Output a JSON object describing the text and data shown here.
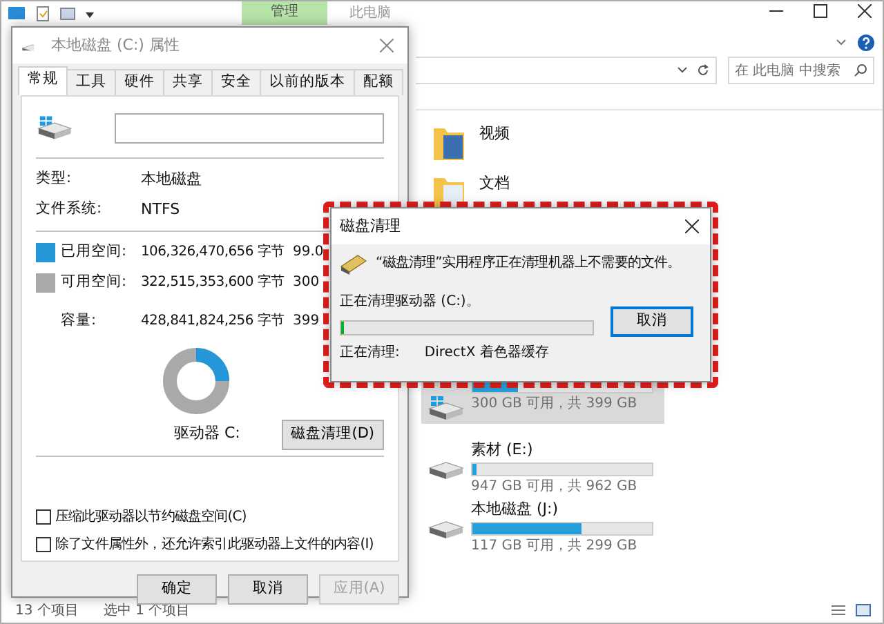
{
  "explorer": {
    "context_tab": "管理",
    "title": "此电脑",
    "search": {
      "placeholder": "在 此电脑 中搜索"
    },
    "folders": [
      {
        "name": "视频"
      },
      {
        "name": "文档"
      }
    ],
    "drives": [
      {
        "selected": true,
        "level": 0.25,
        "info": "300 GB 可用，共 399 GB"
      },
      {
        "name": "素材 (E:)",
        "selected": false,
        "level": 0.02,
        "info": "947 GB 可用，共 962 GB"
      },
      {
        "name": "本地磁盘 (J:)",
        "selected": false,
        "level": 0.61,
        "info": "117 GB 可用，共 299 GB"
      }
    ],
    "status_bar": {
      "count": "13 个项目",
      "selection": "选中 1 个项目"
    }
  },
  "properties": {
    "title": "本地磁盘 (C:) 属性",
    "tabs": [
      {
        "label": "常规",
        "selected": true
      },
      {
        "label": "工具",
        "selected": false
      },
      {
        "label": "硬件",
        "selected": false
      },
      {
        "label": "共享",
        "selected": false
      },
      {
        "label": "安全",
        "selected": false
      },
      {
        "label": "以前的版本",
        "selected": false
      },
      {
        "label": "配额",
        "selected": false
      }
    ],
    "type_label": "类型:",
    "type_value": "本地磁盘",
    "fs_label": "文件系统:",
    "fs_value": "NTFS",
    "space": [
      {
        "kind": "used",
        "color": "#2596d8",
        "label": "已用空间:",
        "bytes": "106,326,470,656 字节",
        "size": "99.0"
      },
      {
        "kind": "free",
        "color": "#a9a9a9",
        "label": "可用空间:",
        "bytes": "322,515,353,600 字节",
        "size": "300"
      },
      {
        "kind": "total",
        "label": "容量:",
        "bytes": "428,841,824,256 字节",
        "size": "399"
      }
    ],
    "drive_label": "驱动器 C:",
    "cleanup_button": "磁盘清理(D)",
    "options": [
      {
        "label": "压缩此驱动器以节约磁盘空间(C)",
        "checked": false
      },
      {
        "label": "除了文件属性外，还允许索引此驱动器上文件的内容(I)",
        "checked": false
      }
    ],
    "buttons": [
      {
        "label": "确定",
        "disabled": false
      },
      {
        "label": "取消",
        "disabled": false
      },
      {
        "label": "应用(A)",
        "disabled": true
      }
    ]
  },
  "cleanup_dialog": {
    "title": "磁盘清理",
    "message": "“磁盘清理”实用程序正在清理机器上不需要的文件。",
    "status": "正在清理驱动器 (C:)。",
    "progress": {
      "level": 0.01
    },
    "cancel_button": "取消",
    "current_label": "正在清理:",
    "current_item": "DirectX 着色器缓存"
  }
}
